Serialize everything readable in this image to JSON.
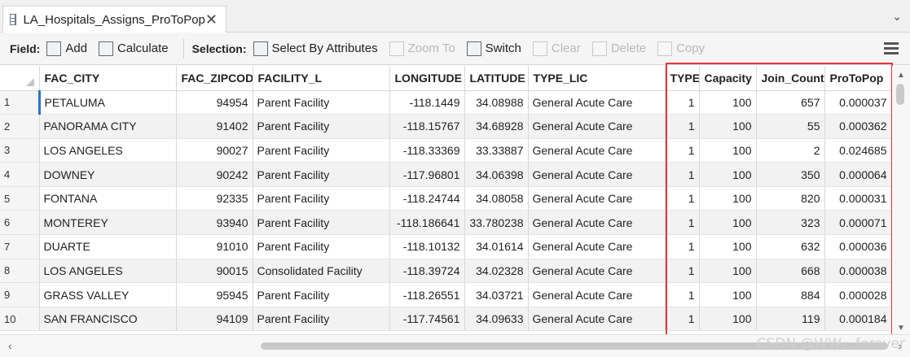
{
  "tab": {
    "title": "LA_Hospitals_Assigns_ProToPop",
    "close": "✕",
    "chevron": "⌄"
  },
  "toolbar": {
    "field_label": "Field:",
    "add": "Add",
    "calculate": "Calculate",
    "selection_label": "Selection:",
    "select_by_attributes": "Select By Attributes",
    "zoom_to": "Zoom To",
    "switch": "Switch",
    "clear": "Clear",
    "delete": "Delete",
    "copy": "Copy"
  },
  "table": {
    "columns": [
      "FAC_CITY",
      "FAC_ZIPCOD",
      "FACILITY_L",
      "LONGITUDE",
      "LATITUDE",
      "TYPE_LIC",
      "TYPE",
      "Capacity",
      "Join_Count",
      "ProToPop"
    ],
    "rows": [
      [
        "1",
        "PETALUMA",
        "94954",
        "Parent Facility",
        "-118.1449",
        "34.08988",
        "General Acute Care",
        "1",
        "100",
        "657",
        "0.000037"
      ],
      [
        "2",
        "PANORAMA CITY",
        "91402",
        "Parent Facility",
        "-118.15767",
        "34.68928",
        "General Acute Care",
        "1",
        "100",
        "55",
        "0.000362"
      ],
      [
        "3",
        "LOS ANGELES",
        "90027",
        "Parent Facility",
        "-118.33369",
        "33.33887",
        "General Acute Care",
        "1",
        "100",
        "2",
        "0.024685"
      ],
      [
        "4",
        "DOWNEY",
        "90242",
        "Parent Facility",
        "-117.96801",
        "34.06398",
        "General Acute Care",
        "1",
        "100",
        "350",
        "0.000064"
      ],
      [
        "5",
        "FONTANA",
        "92335",
        "Parent Facility",
        "-118.24744",
        "34.08058",
        "General Acute Care",
        "1",
        "100",
        "820",
        "0.000031"
      ],
      [
        "6",
        "MONTEREY",
        "93940",
        "Parent Facility",
        "-118.186641",
        "33.780238",
        "General Acute Care",
        "1",
        "100",
        "323",
        "0.000071"
      ],
      [
        "7",
        "DUARTE",
        "91010",
        "Parent Facility",
        "-118.10132",
        "34.01614",
        "General Acute Care",
        "1",
        "100",
        "632",
        "0.000036"
      ],
      [
        "8",
        "LOS ANGELES",
        "90015",
        "Consolidated Facility",
        "-118.39724",
        "34.02328",
        "General Acute Care",
        "1",
        "100",
        "668",
        "0.000038"
      ],
      [
        "9",
        "GRASS VALLEY",
        "95945",
        "Parent Facility",
        "-118.26551",
        "34.03721",
        "General Acute Care",
        "1",
        "100",
        "884",
        "0.000028"
      ],
      [
        "10",
        "SAN FRANCISCO",
        "94109",
        "Parent Facility",
        "-117.74561",
        "34.09633",
        "General Acute Care",
        "1",
        "100",
        "119",
        "0.000184"
      ]
    ]
  },
  "highlight_color": "#e23a3a",
  "watermark": "CSDN @WW、forever"
}
